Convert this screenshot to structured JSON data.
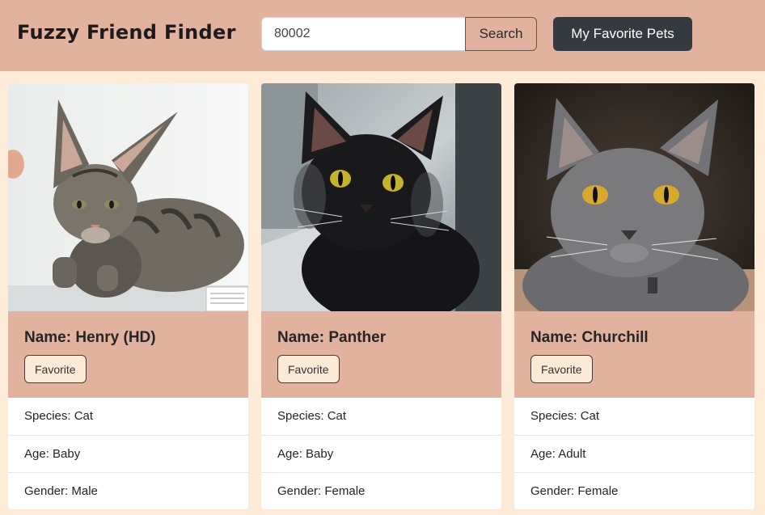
{
  "header": {
    "brand": "Fuzzy Friend Finder",
    "search_value": "80002",
    "search_label": "Search",
    "favorites_label": "My Favorite Pets"
  },
  "pets": [
    {
      "name": "Name: Henry (HD)",
      "favorite_label": "Favorite",
      "species": "Species: Cat",
      "age": "Age: Baby",
      "gender": "Gender: Male"
    },
    {
      "name": "Name: Panther",
      "favorite_label": "Favorite",
      "species": "Species: Cat",
      "age": "Age: Baby",
      "gender": "Gender: Female"
    },
    {
      "name": "Name: Churchill",
      "favorite_label": "Favorite",
      "species": "Species: Cat",
      "age": "Age: Adult",
      "gender": "Gender: Female"
    }
  ],
  "colors": {
    "page_background": "#fdebd8",
    "accent": "#e1b29e",
    "dark_button": "#343a40"
  }
}
